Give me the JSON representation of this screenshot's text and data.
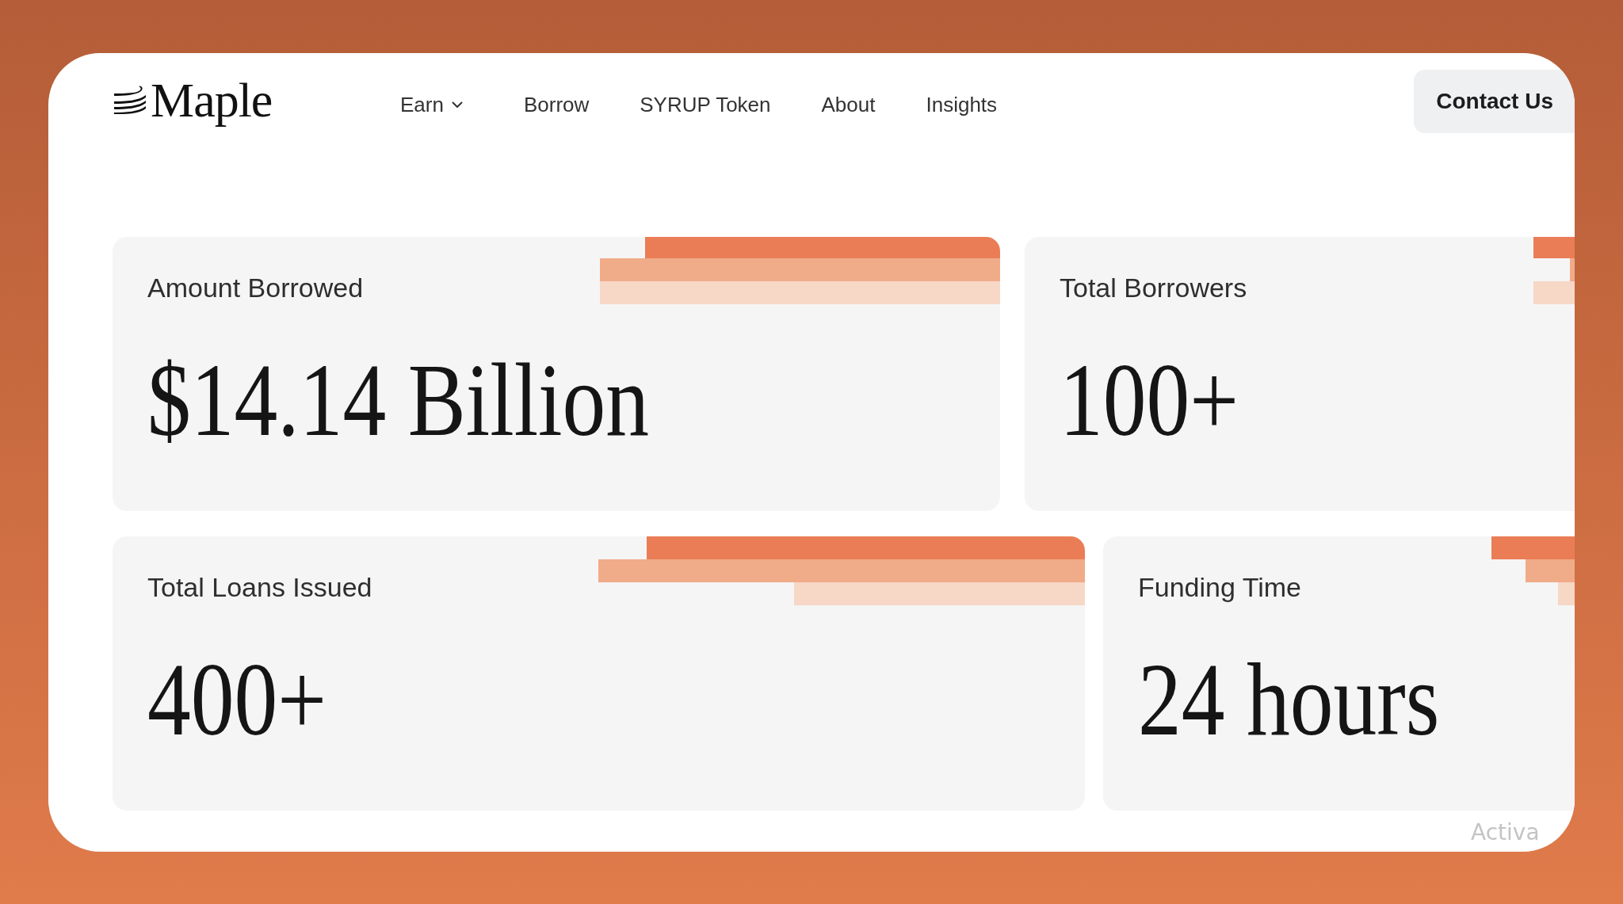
{
  "header": {
    "logo": "Maple",
    "nav": [
      {
        "label": "Earn",
        "has_menu": true
      },
      {
        "label": "Borrow",
        "has_menu": false
      },
      {
        "label": "SYRUP Token",
        "has_menu": false
      },
      {
        "label": "About",
        "has_menu": false
      },
      {
        "label": "Insights",
        "has_menu": false
      }
    ],
    "contact_button": "Contact Us"
  },
  "stats": [
    {
      "label": "Amount Borrowed",
      "value": "$14.14 Billion"
    },
    {
      "label": "Total Borrowers",
      "value": "100+"
    },
    {
      "label": "Total Loans Issued",
      "value": "400+"
    },
    {
      "label": "Funding Time",
      "value": "24 hours"
    }
  ],
  "os_notice": "Activa"
}
